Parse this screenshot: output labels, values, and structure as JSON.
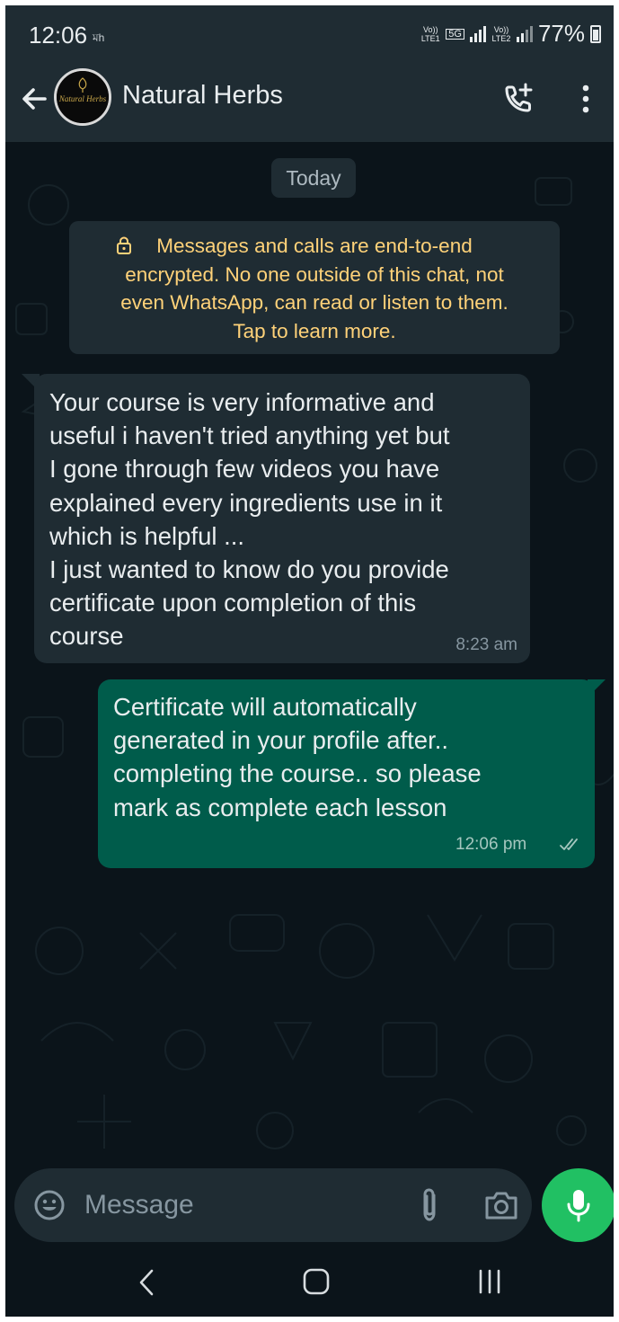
{
  "status_bar": {
    "time": "12:06",
    "notification_indicator": "মh",
    "sim1_tag": "Vo)) LTE1",
    "network_5g": "5G",
    "sim2_tag": "Vo)) LTE2",
    "battery": "77%"
  },
  "header": {
    "contact_name": "Natural Herbs",
    "avatar_text": "Natural Herbs"
  },
  "chat": {
    "date_chip": "Today",
    "encryption_notice": "Messages and calls are end-to-end\nencrypted. No one outside of this chat, not\neven WhatsApp, can read or listen to them.\nTap to learn more.",
    "messages": [
      {
        "direction": "incoming",
        "text": "Your course is very informative and\nuseful i haven't tried anything yet but\nI gone through few videos you have\nexplained every ingredients use in it\nwhich is helpful ...\nI just wanted to know do you provide\ncertificate upon completion of this\ncourse",
        "time": "8:23 am"
      },
      {
        "direction": "outgoing",
        "text": "Certificate will automatically\ngenerated in your profile after..\ncompleting the course.. so please\nmark as complete each lesson",
        "time": "12:06 pm",
        "status": "read"
      }
    ]
  },
  "input": {
    "placeholder": "Message"
  },
  "colors": {
    "background": "#0b141a",
    "bar": "#1f2c33",
    "outgoing_bubble": "#005c4b",
    "notice_text": "#ffd279",
    "accent": "#21c063"
  },
  "icons": {
    "back": "arrow-left-icon",
    "call": "add-call-icon",
    "menu": "vertical-dots-icon",
    "lock": "lock-icon",
    "emoji": "emoji-icon",
    "attach": "paperclip-icon",
    "camera": "camera-icon",
    "mic": "mic-icon",
    "read": "double-check-icon"
  }
}
